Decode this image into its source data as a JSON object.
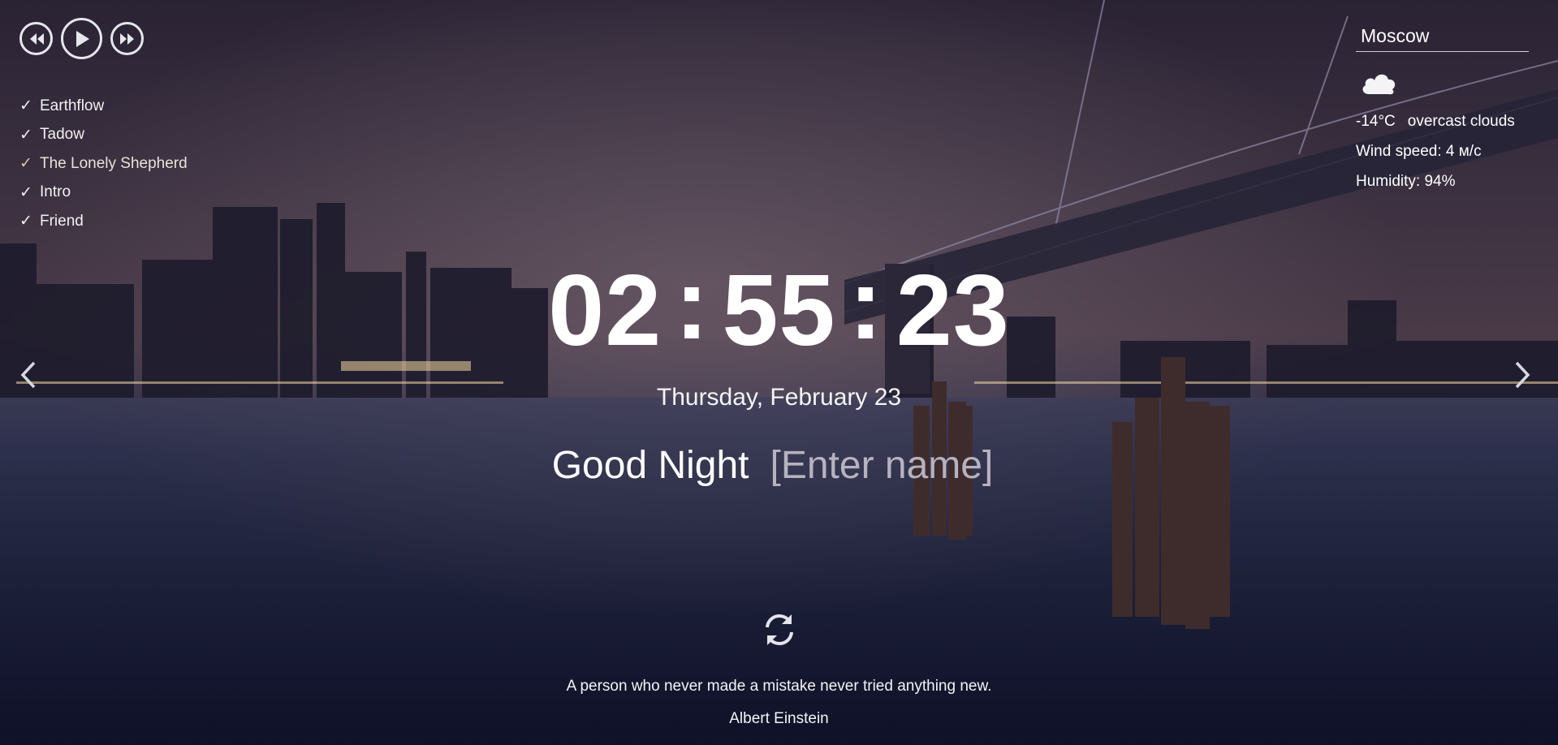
{
  "player": {
    "prev_icon": "rewind-icon",
    "play_icon": "play-icon",
    "next_icon": "fast-forward-icon",
    "tracks": [
      {
        "title": "Earthflow",
        "active": false
      },
      {
        "title": "Tadow",
        "active": false
      },
      {
        "title": "The Lonely Shepherd",
        "active": true
      },
      {
        "title": "Intro",
        "active": false
      },
      {
        "title": "Friend",
        "active": false
      }
    ],
    "check_glyph": "✓",
    "active_color": "#d9c79a"
  },
  "weather": {
    "city": "Moscow",
    "icon": "cloud-icon",
    "temperature": "-14°C",
    "description": "overcast clouds",
    "wind": "Wind speed: 4 м/с",
    "humidity": "Humidity: 94%"
  },
  "clock": {
    "hours": "02",
    "minutes": "55",
    "seconds": "23",
    "separator": ":"
  },
  "date": "Thursday, February 23",
  "greeting": {
    "text": "Good Night",
    "name_placeholder": "[Enter name]"
  },
  "quote": {
    "refresh_icon": "refresh-icon",
    "text": "A person who never made a mistake never tried anything new.",
    "author": "Albert Einstein"
  },
  "navigation": {
    "prev_icon": "chevron-left-icon",
    "next_icon": "chevron-right-icon"
  }
}
